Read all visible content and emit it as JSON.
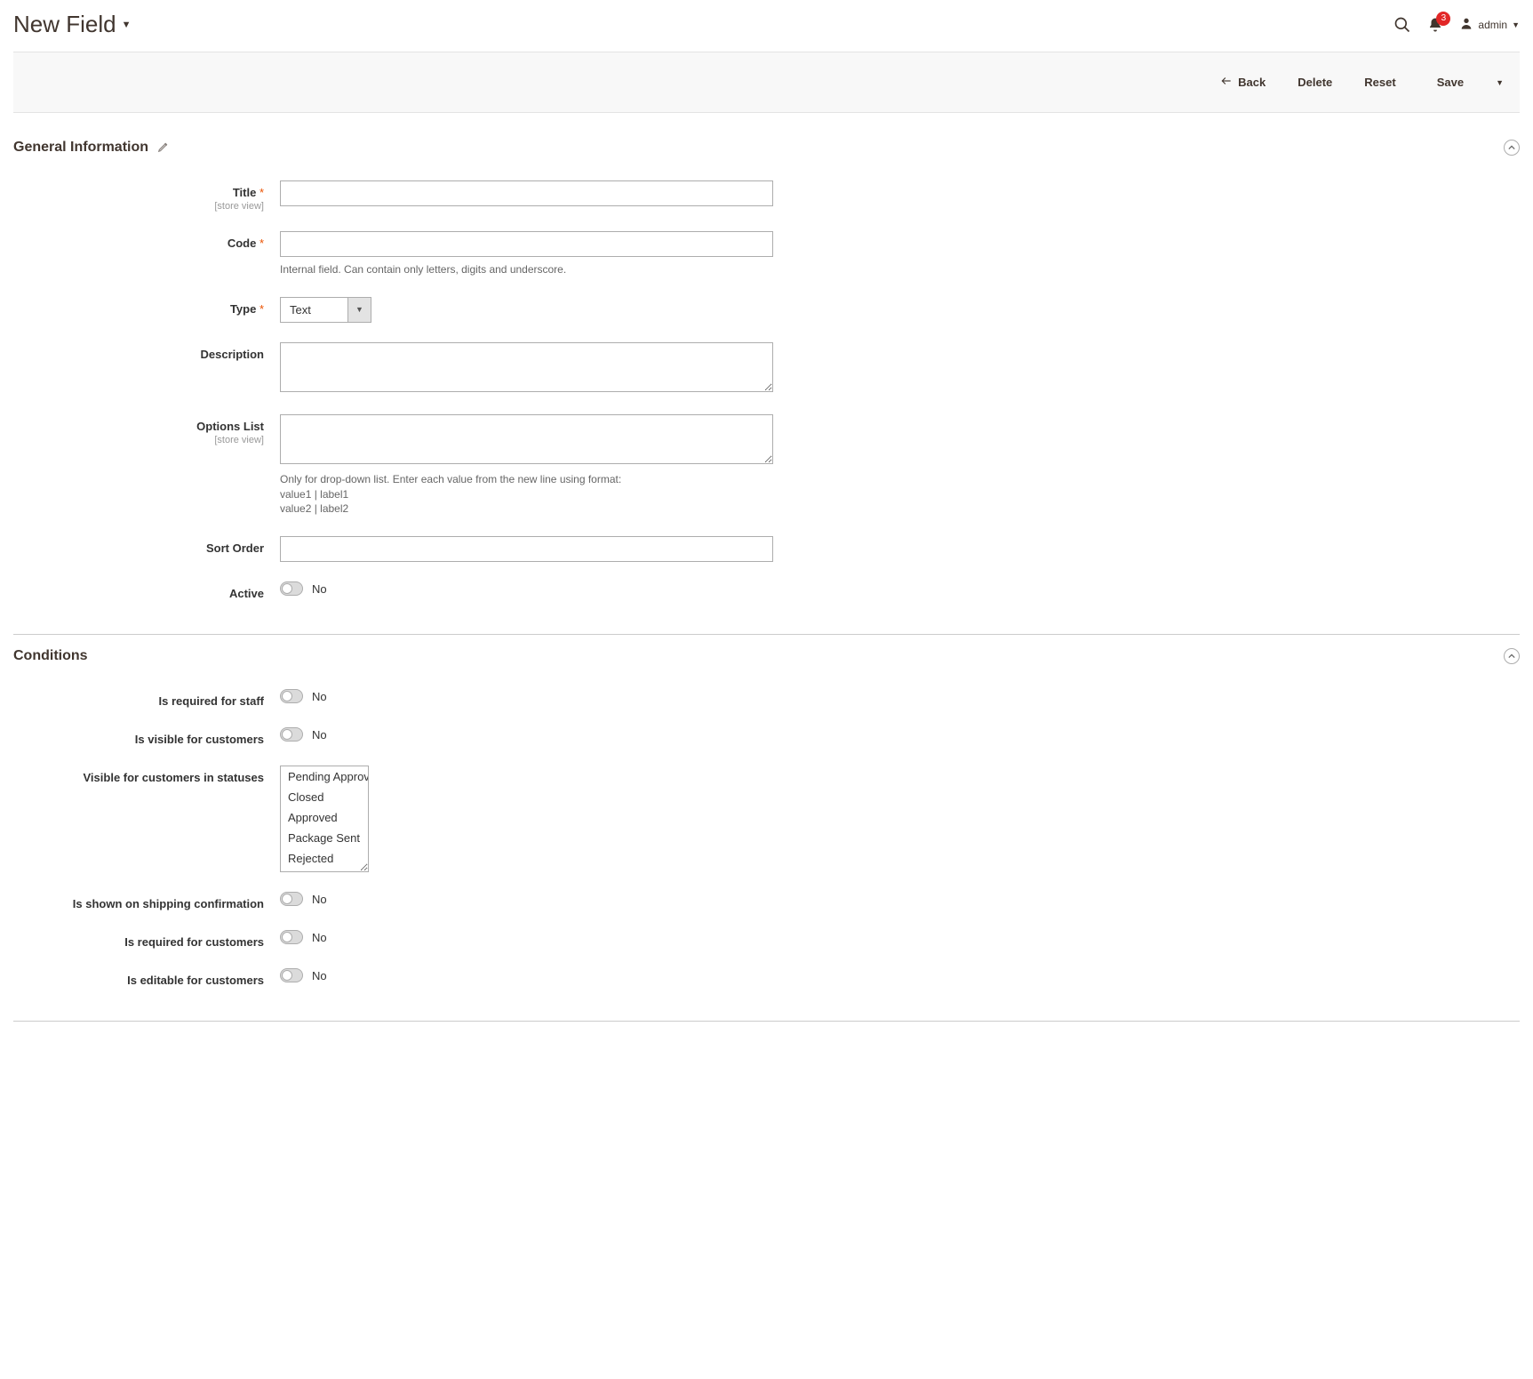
{
  "header": {
    "title": "New Field",
    "notifications_count": "3",
    "admin_label": "admin"
  },
  "toolbar": {
    "back_label": "Back",
    "delete_label": "Delete",
    "reset_label": "Reset",
    "save_label": "Save"
  },
  "sections": {
    "general": {
      "title": "General Information",
      "fields": {
        "title": {
          "label": "Title",
          "scope": "[store view]",
          "value": ""
        },
        "code": {
          "label": "Code",
          "value": "",
          "hint": "Internal field. Can contain only letters, digits and underscore."
        },
        "type": {
          "label": "Type",
          "value": "Text"
        },
        "description": {
          "label": "Description",
          "value": ""
        },
        "options_list": {
          "label": "Options List",
          "scope": "[store view]",
          "value": "",
          "hint_line1": "Only for drop-down list. Enter each value from the new line using format:",
          "hint_line2": "value1 | label1",
          "hint_line3": "value2 | label2"
        },
        "sort_order": {
          "label": "Sort Order",
          "value": ""
        },
        "active": {
          "label": "Active",
          "value_label": "No"
        }
      }
    },
    "conditions": {
      "title": "Conditions",
      "fields": {
        "required_staff": {
          "label": "Is required for staff",
          "value_label": "No"
        },
        "visible_customers": {
          "label": "Is visible for customers",
          "value_label": "No"
        },
        "visible_statuses": {
          "label": "Visible for customers in statuses",
          "options": [
            "Pending Approval",
            "Closed",
            "Approved",
            "Package Sent",
            "Rejected"
          ]
        },
        "shown_shipping": {
          "label": "Is shown on shipping confirmation",
          "value_label": "No"
        },
        "required_customers": {
          "label": "Is required for customers",
          "value_label": "No"
        },
        "editable_customers": {
          "label": "Is editable for customers",
          "value_label": "No"
        }
      }
    }
  }
}
